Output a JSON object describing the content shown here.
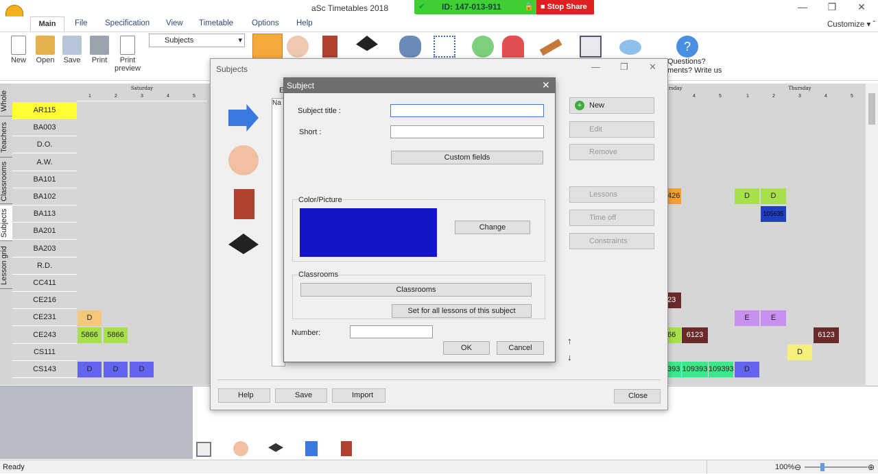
{
  "app": {
    "title": "aSc Timetables 2018",
    "share_id": "ID: 147-013-911",
    "stop_share": "Stop Share"
  },
  "window_controls": {
    "minimize": "—",
    "maximize": "❐",
    "close": "✕"
  },
  "ribbon": {
    "tabs": [
      "Main",
      "File",
      "Specification",
      "View",
      "Timetable",
      "Options",
      "Help"
    ],
    "customize": "Customize ▾ ˆ",
    "buttons": {
      "new": "New",
      "open": "Open",
      "save": "Save",
      "print": "Print",
      "print_preview": "Print preview"
    },
    "selector": "Subjects",
    "questions": "Questions?",
    "comments": "ments? Write us"
  },
  "vertical_tabs": [
    "Whole",
    "Teachers",
    "Classrooms",
    "Subjects",
    "Lesson grid"
  ],
  "grid": {
    "day_saturday": "Saturday",
    "day_thursday": "Thursday",
    "day_partial": "rsday",
    "periods": [
      "1",
      "2",
      "3",
      "4",
      "5"
    ],
    "rows": [
      "AR115",
      "BA003",
      "D.O.",
      "A.W.",
      "BA101",
      "BA102",
      "BA113",
      "BA201",
      "BA203",
      "R.D.",
      "CC411",
      "CE216",
      "CE231",
      "CE243",
      "CS111",
      "CS143"
    ],
    "cells": {
      "ce231_1": "D",
      "ce243_1": "5866",
      "ce243_2": "5866",
      "cs143_1": "D",
      "cs143_2": "D",
      "cs143_3": "D",
      "r_ba102_a": "426",
      "r_ce216_a": "23",
      "r_ce243_a": "66",
      "r_ce243_b": "6123",
      "r_cs143_a": "393",
      "r_cs143_b": "109393",
      "r_cs143_c": "109393",
      "t_ba102_1": "D",
      "t_ba102_2": "D",
      "t_ba113_2": "105635",
      "t_ce231_1": "E",
      "t_ce231_2": "E",
      "t_ce243_4": "6123",
      "t_cs111_3": "D",
      "t_cs143_1": "D"
    }
  },
  "subjects_window": {
    "title": "Subjects",
    "list_header_letter": "E",
    "list_col": "Na",
    "side_buttons": {
      "new": "New",
      "edit": "Edit",
      "remove": "Remove",
      "lessons": "Lessons",
      "time_off": "Time off",
      "constraints": "Constraints"
    },
    "bottom_buttons": {
      "help": "Help",
      "save": "Save",
      "import": "Import",
      "close": "Close"
    }
  },
  "dialog": {
    "title": "Subject",
    "subject_title_label": "Subject title :",
    "short_label": "Short :",
    "subject_title_value": "",
    "short_value": "",
    "custom_fields": "Custom fields",
    "color_group": "Color/Picture",
    "change": "Change",
    "color": "#1414c8",
    "classrooms_group": "Classrooms",
    "classrooms_btn": "Classrooms",
    "set_all": "Set for all lessons of this subject",
    "number_label": "Number:",
    "number_value": "",
    "ok": "OK",
    "cancel": "Cancel"
  },
  "status": {
    "text": "Ready",
    "zoom": "100%"
  }
}
